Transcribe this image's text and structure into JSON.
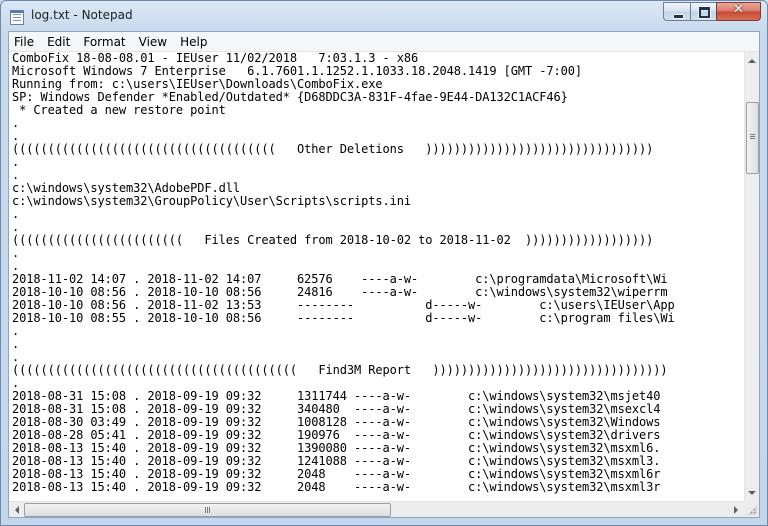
{
  "window": {
    "title": "log.txt - Notepad"
  },
  "menu": {
    "items": [
      {
        "label": "File"
      },
      {
        "label": "Edit"
      },
      {
        "label": "Format"
      },
      {
        "label": "View"
      },
      {
        "label": "Help"
      }
    ]
  },
  "editor": {
    "lines": [
      "ComboFix 18-08-08.01 - IEUser 11/02/2018   7:03.1.3 - x86",
      "Microsoft Windows 7 Enterprise   6.1.7601.1.1252.1.1033.18.2048.1419 [GMT -7:00]",
      "Running from: c:\\users\\IEUser\\Downloads\\ComboFix.exe",
      "SP: Windows Defender *Enabled/Outdated* {D68DDC3A-831F-4fae-9E44-DA132C1ACF46}",
      " * Created a new restore point",
      ".",
      ".",
      "(((((((((((((((((((((((((((((((((((((   Other Deletions   ))))))))))))))))))))))))))))))))",
      ".",
      ".",
      "c:\\windows\\system32\\AdobePDF.dll",
      "c:\\windows\\system32\\GroupPolicy\\User\\Scripts\\scripts.ini",
      ".",
      ".",
      "((((((((((((((((((((((((   Files Created from 2018-10-02 to 2018-11-02  ))))))))))))))))))",
      ".",
      ".",
      "2018-11-02 14:07 . 2018-11-02 14:07     62576    ----a-w-        c:\\programdata\\Microsoft\\Wi",
      "2018-10-10 08:56 . 2018-10-10 08:56     24816    ----a-w-        c:\\windows\\system32\\wiperrm",
      "2018-10-10 08:56 . 2018-11-02 13:53     --------          d-----w-        c:\\users\\IEUser\\App",
      "2018-10-10 08:55 . 2018-10-10 08:56     --------          d-----w-        c:\\program files\\Wi",
      ".",
      ".",
      ".",
      "((((((((((((((((((((((((((((((((((((((((   Find3M Report   )))))))))))))))))))))))))))))))))",
      ".",
      "2018-08-31 15:08 . 2018-09-19 09:32     1311744 ----a-w-        c:\\windows\\system32\\msjet40",
      "2018-08-31 15:08 . 2018-09-19 09:32     340480  ----a-w-        c:\\windows\\system32\\msexcl4",
      "2018-08-30 03:49 . 2018-09-19 09:32     1008128 ----a-w-        c:\\windows\\system32\\Windows",
      "2018-08-28 05:41 . 2018-09-19 09:32     190976  ----a-w-        c:\\windows\\system32\\drivers",
      "2018-08-13 15:40 . 2018-09-19 09:32     1390080 ----a-w-        c:\\windows\\system32\\msxml6.",
      "2018-08-13 15:40 . 2018-09-19 09:32     1241088 ----a-w-        c:\\windows\\system32\\msxml3.",
      "2018-08-13 15:40 . 2018-09-19 09:32     2048    ----a-w-        c:\\windows\\system32\\msxml6r",
      "2018-08-13 15:40 . 2018-09-19 09:32     2048    ----a-w-        c:\\windows\\system32\\msxml3r"
    ]
  }
}
